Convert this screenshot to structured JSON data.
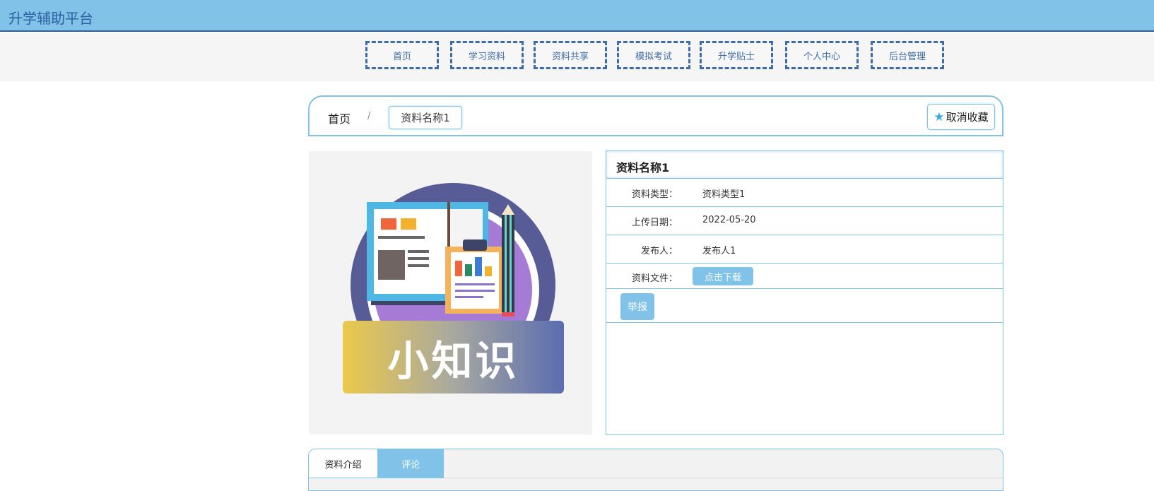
{
  "app": {
    "title": "升学辅助平台"
  },
  "nav": {
    "items": [
      {
        "label": "首页"
      },
      {
        "label": "学习资料"
      },
      {
        "label": "资料共享"
      },
      {
        "label": "模拟考试"
      },
      {
        "label": "升学贴士"
      },
      {
        "label": "个人中心"
      },
      {
        "label": "后台管理"
      }
    ]
  },
  "breadcrumb": {
    "home": "首页",
    "separator": "/",
    "current": "资料名称1"
  },
  "favorite": {
    "icon": "star-icon",
    "label": "取消收藏"
  },
  "cover": {
    "caption": "小知识"
  },
  "detail": {
    "title": "资料名称1",
    "rows": [
      {
        "label": "资料类型：",
        "value": "资料类型1"
      },
      {
        "label": "上传日期：",
        "value": "2022-05-20"
      },
      {
        "label": "发布人：",
        "value": "发布人1"
      },
      {
        "label": "资料文件：",
        "button": "点击下载"
      }
    ],
    "report_label": "举报"
  },
  "tabs": [
    {
      "label": "资料介绍"
    },
    {
      "label": "评论"
    }
  ],
  "colors": {
    "accent": "#81c3e8",
    "nav_border": "#3f6ca8",
    "brand_text": "#2d5d9f"
  }
}
